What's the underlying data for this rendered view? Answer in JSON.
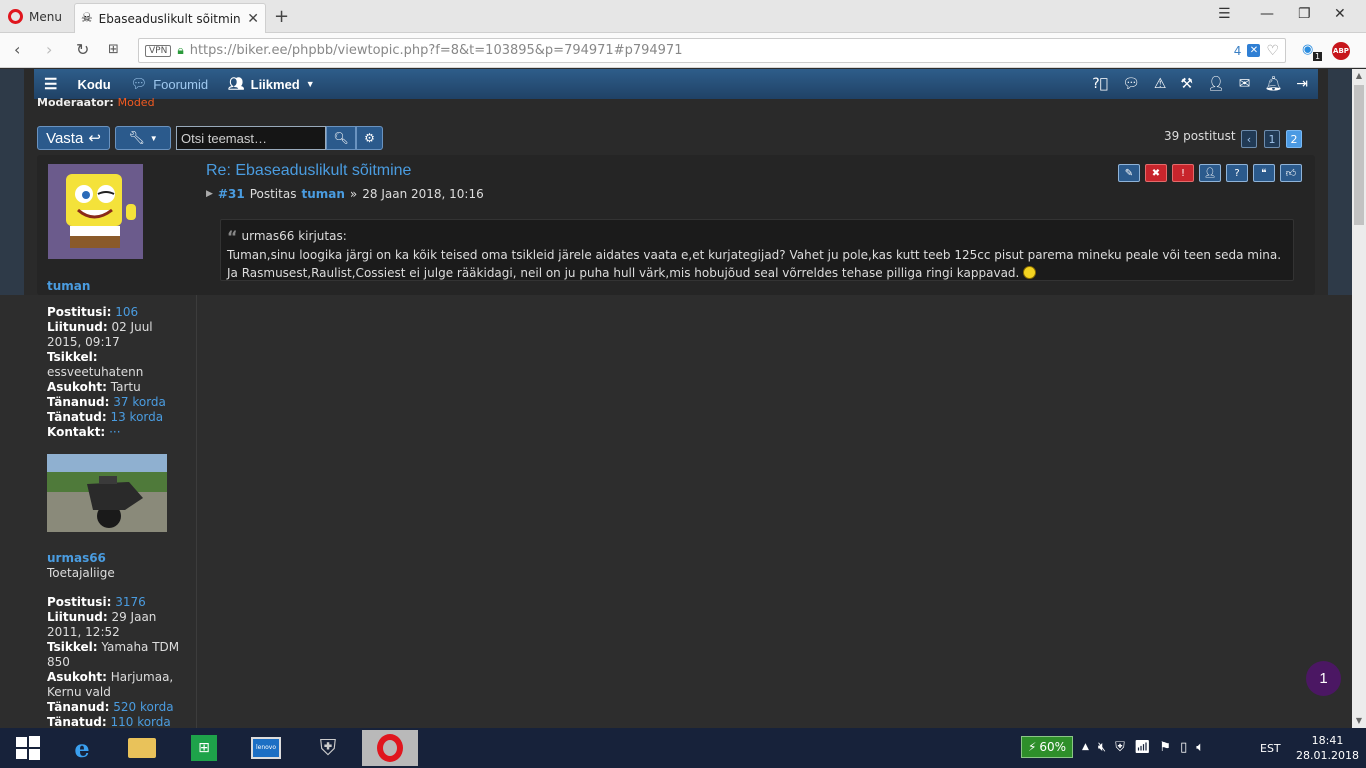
{
  "browser": {
    "menu_label": "Menu",
    "tab_title": "Ebaseaduslikult sõitmine -",
    "vpn_label": "VPN",
    "url": "https://biker.ee/phpbb/viewtopic.php?f=8&t=103895&p=794971#p794971",
    "blocked_count": "4",
    "ext_badge": "1",
    "abp_label": "ABP"
  },
  "nav": {
    "home": "Kodu",
    "forums": "Foorumid",
    "members": "Liikmed"
  },
  "moderator": {
    "label": "Moderaator:",
    "name": "Moded"
  },
  "actions": {
    "reply": "Vasta",
    "search_placeholder": "Otsi teemast…",
    "post_count": "39 postitust",
    "pages": [
      "1",
      "2"
    ]
  },
  "post": {
    "title": "Re: Ebaseaduslikult sõitmine",
    "number": "#31",
    "posted_by": "Postitas",
    "author": "tuman",
    "sep": "»",
    "date": "28 Jaan 2018, 10:16",
    "quote_author": "urmas66 kirjutas:",
    "quote_text": "Tuman,sinu loogika järgi on ka kõik teised oma tsikleid järele aidates vaata e,et kurjategijad? Vahet ju pole,kas kutt teeb 125cc pisut parema mineku peale või teen seda mina. Ja Rasmusest,Raulist,Cossiest ei julge rääkidagi, neil on ju puha hull värk,mis hobujõud seal võrreldes tehase pilliga ringi kappavad."
  },
  "user1": {
    "name": "tuman",
    "stats": [
      {
        "label": "Postitusi:",
        "value": "106",
        "link": true
      },
      {
        "label": "Liitunud:",
        "value": "02 Juul 2015, 09:17",
        "link": false
      },
      {
        "label": "Tsikkel:",
        "value": "essveetuhatenn",
        "link": false
      },
      {
        "label": "Asukoht:",
        "value": "Tartu",
        "link": false
      },
      {
        "label": "Tänanud:",
        "value": "37 korda",
        "link": true
      },
      {
        "label": "Tänatud:",
        "value": "13 korda",
        "link": true
      },
      {
        "label": "Kontakt:",
        "value": "···",
        "link": true
      }
    ]
  },
  "user2": {
    "name": "urmas66",
    "rank": "Toetajaliige",
    "stats": [
      {
        "label": "Postitusi:",
        "value": "3176",
        "link": true
      },
      {
        "label": "Liitunud:",
        "value": "29 Jaan 2011, 12:52",
        "link": false
      },
      {
        "label": "Tsikkel:",
        "value": "Yamaha TDM 850",
        "link": false
      },
      {
        "label": "Asukoht:",
        "value": "Harjumaa, Kernu vald",
        "link": false
      },
      {
        "label": "Tänanud:",
        "value": "520 korda",
        "link": true
      },
      {
        "label": "Tänatud:",
        "value": "110 korda",
        "link": true
      }
    ]
  },
  "notification_count": "1",
  "taskbar": {
    "battery": "60%",
    "lang": "EST",
    "time": "18:41",
    "date": "28.01.2018"
  },
  "colors": {
    "link": "#4a9ce0",
    "navbar": "#2b5a8c",
    "moderator": "#f15a22",
    "notification": "#4b1763"
  }
}
